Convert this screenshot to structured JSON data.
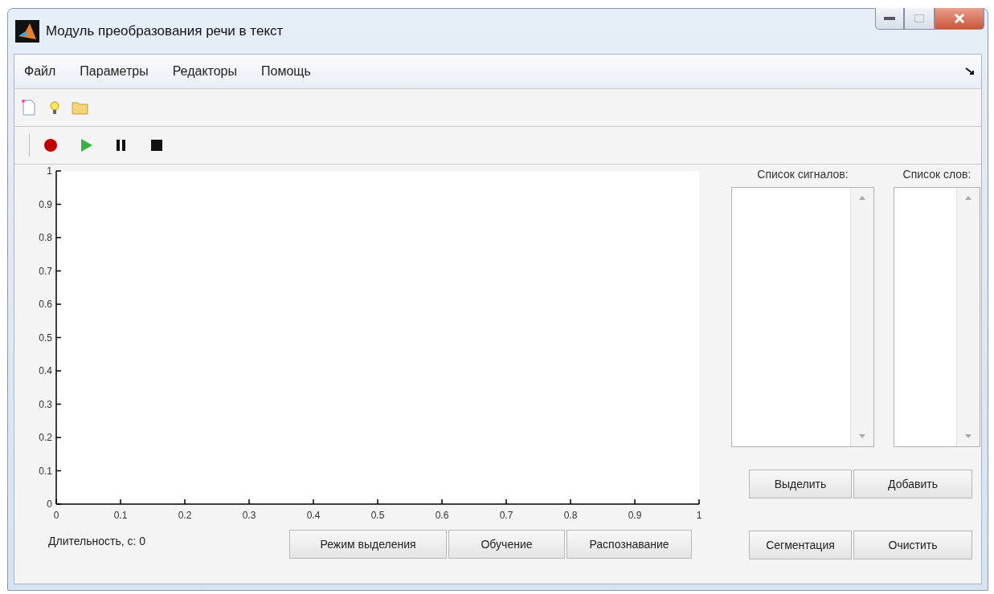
{
  "window": {
    "title": "Модуль преобразования речи в текст"
  },
  "menu": [
    {
      "label": "Файл"
    },
    {
      "label": "Параметры"
    },
    {
      "label": "Редакторы"
    },
    {
      "label": "Помощь"
    }
  ],
  "toolbar": [
    {
      "kind": "new"
    },
    {
      "kind": "bulb"
    },
    {
      "kind": "open"
    }
  ],
  "playback": [
    {
      "kind": "record"
    },
    {
      "kind": "play"
    },
    {
      "kind": "pause"
    },
    {
      "kind": "stop"
    }
  ],
  "plot": {
    "chart_data": {
      "type": "line",
      "xlim": [
        0,
        1
      ],
      "ylim": [
        0,
        1
      ],
      "xticks": [
        0,
        0.1,
        0.2,
        0.3,
        0.4,
        0.5,
        0.6,
        0.7,
        0.8,
        0.9,
        1
      ],
      "yticks": [
        0,
        0.1,
        0.2,
        0.3,
        0.4,
        0.5,
        0.6,
        0.7,
        0.8,
        0.9,
        1
      ]
    }
  },
  "duration": "Длительность, с: 0",
  "mode_buttons": [
    "Режим выделения",
    "Обучение",
    "Распознавание"
  ],
  "lists": [
    {
      "label": "Список сигналов:"
    },
    {
      "label": "Список слов:"
    }
  ],
  "list_buttons": [
    "Выделить",
    "Добавить"
  ],
  "action_buttons": [
    "Сегментация",
    "Очистить"
  ]
}
